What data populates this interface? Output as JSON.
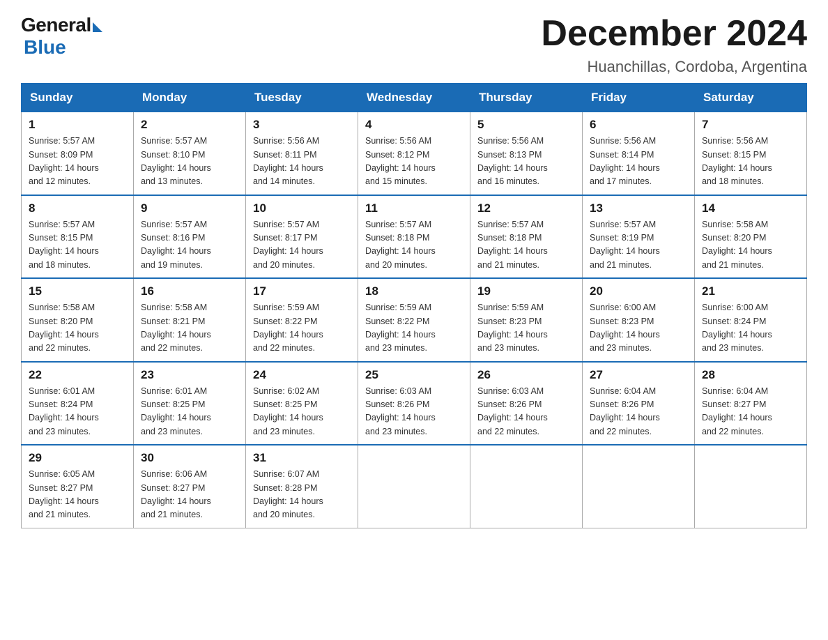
{
  "header": {
    "logo_general": "General",
    "logo_blue": "Blue",
    "title": "December 2024",
    "subtitle": "Huanchillas, Cordoba, Argentina"
  },
  "days_of_week": [
    "Sunday",
    "Monday",
    "Tuesday",
    "Wednesday",
    "Thursday",
    "Friday",
    "Saturday"
  ],
  "weeks": [
    [
      {
        "day": "1",
        "sunrise": "5:57 AM",
        "sunset": "8:09 PM",
        "daylight": "14 hours and 12 minutes."
      },
      {
        "day": "2",
        "sunrise": "5:57 AM",
        "sunset": "8:10 PM",
        "daylight": "14 hours and 13 minutes."
      },
      {
        "day": "3",
        "sunrise": "5:56 AM",
        "sunset": "8:11 PM",
        "daylight": "14 hours and 14 minutes."
      },
      {
        "day": "4",
        "sunrise": "5:56 AM",
        "sunset": "8:12 PM",
        "daylight": "14 hours and 15 minutes."
      },
      {
        "day": "5",
        "sunrise": "5:56 AM",
        "sunset": "8:13 PM",
        "daylight": "14 hours and 16 minutes."
      },
      {
        "day": "6",
        "sunrise": "5:56 AM",
        "sunset": "8:14 PM",
        "daylight": "14 hours and 17 minutes."
      },
      {
        "day": "7",
        "sunrise": "5:56 AM",
        "sunset": "8:15 PM",
        "daylight": "14 hours and 18 minutes."
      }
    ],
    [
      {
        "day": "8",
        "sunrise": "5:57 AM",
        "sunset": "8:15 PM",
        "daylight": "14 hours and 18 minutes."
      },
      {
        "day": "9",
        "sunrise": "5:57 AM",
        "sunset": "8:16 PM",
        "daylight": "14 hours and 19 minutes."
      },
      {
        "day": "10",
        "sunrise": "5:57 AM",
        "sunset": "8:17 PM",
        "daylight": "14 hours and 20 minutes."
      },
      {
        "day": "11",
        "sunrise": "5:57 AM",
        "sunset": "8:18 PM",
        "daylight": "14 hours and 20 minutes."
      },
      {
        "day": "12",
        "sunrise": "5:57 AM",
        "sunset": "8:18 PM",
        "daylight": "14 hours and 21 minutes."
      },
      {
        "day": "13",
        "sunrise": "5:57 AM",
        "sunset": "8:19 PM",
        "daylight": "14 hours and 21 minutes."
      },
      {
        "day": "14",
        "sunrise": "5:58 AM",
        "sunset": "8:20 PM",
        "daylight": "14 hours and 21 minutes."
      }
    ],
    [
      {
        "day": "15",
        "sunrise": "5:58 AM",
        "sunset": "8:20 PM",
        "daylight": "14 hours and 22 minutes."
      },
      {
        "day": "16",
        "sunrise": "5:58 AM",
        "sunset": "8:21 PM",
        "daylight": "14 hours and 22 minutes."
      },
      {
        "day": "17",
        "sunrise": "5:59 AM",
        "sunset": "8:22 PM",
        "daylight": "14 hours and 22 minutes."
      },
      {
        "day": "18",
        "sunrise": "5:59 AM",
        "sunset": "8:22 PM",
        "daylight": "14 hours and 23 minutes."
      },
      {
        "day": "19",
        "sunrise": "5:59 AM",
        "sunset": "8:23 PM",
        "daylight": "14 hours and 23 minutes."
      },
      {
        "day": "20",
        "sunrise": "6:00 AM",
        "sunset": "8:23 PM",
        "daylight": "14 hours and 23 minutes."
      },
      {
        "day": "21",
        "sunrise": "6:00 AM",
        "sunset": "8:24 PM",
        "daylight": "14 hours and 23 minutes."
      }
    ],
    [
      {
        "day": "22",
        "sunrise": "6:01 AM",
        "sunset": "8:24 PM",
        "daylight": "14 hours and 23 minutes."
      },
      {
        "day": "23",
        "sunrise": "6:01 AM",
        "sunset": "8:25 PM",
        "daylight": "14 hours and 23 minutes."
      },
      {
        "day": "24",
        "sunrise": "6:02 AM",
        "sunset": "8:25 PM",
        "daylight": "14 hours and 23 minutes."
      },
      {
        "day": "25",
        "sunrise": "6:03 AM",
        "sunset": "8:26 PM",
        "daylight": "14 hours and 23 minutes."
      },
      {
        "day": "26",
        "sunrise": "6:03 AM",
        "sunset": "8:26 PM",
        "daylight": "14 hours and 22 minutes."
      },
      {
        "day": "27",
        "sunrise": "6:04 AM",
        "sunset": "8:26 PM",
        "daylight": "14 hours and 22 minutes."
      },
      {
        "day": "28",
        "sunrise": "6:04 AM",
        "sunset": "8:27 PM",
        "daylight": "14 hours and 22 minutes."
      }
    ],
    [
      {
        "day": "29",
        "sunrise": "6:05 AM",
        "sunset": "8:27 PM",
        "daylight": "14 hours and 21 minutes."
      },
      {
        "day": "30",
        "sunrise": "6:06 AM",
        "sunset": "8:27 PM",
        "daylight": "14 hours and 21 minutes."
      },
      {
        "day": "31",
        "sunrise": "6:07 AM",
        "sunset": "8:28 PM",
        "daylight": "14 hours and 20 minutes."
      },
      null,
      null,
      null,
      null
    ]
  ],
  "labels": {
    "sunrise": "Sunrise:",
    "sunset": "Sunset:",
    "daylight": "Daylight:"
  }
}
